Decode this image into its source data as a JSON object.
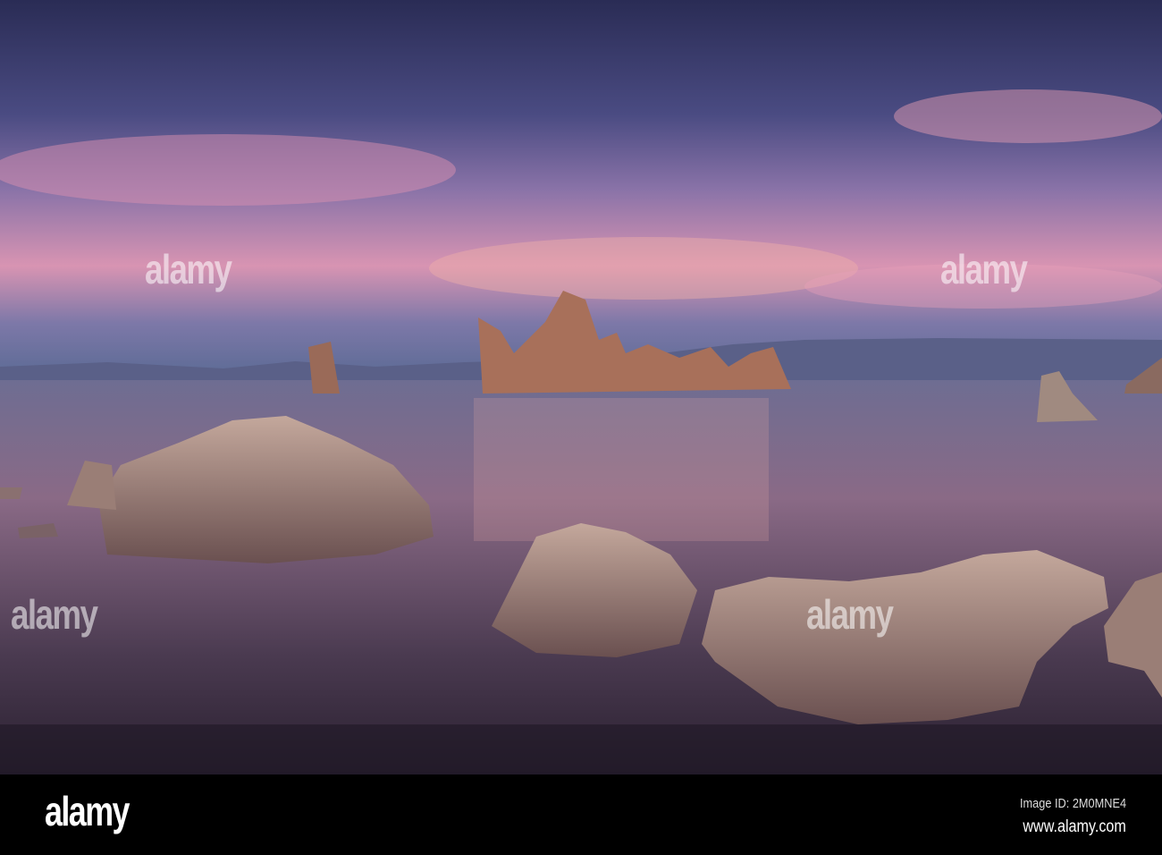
{
  "watermark": {
    "logo_text": "alamy"
  },
  "footer": {
    "logo": "alamy",
    "image_id": "Image ID: 2M0MNE4",
    "url": "www.alamy.com"
  },
  "colors": {
    "sky_top": "#2f3460",
    "sky_pink": "#d98fb0",
    "water": "#6c5a78",
    "rock": "#a08478"
  }
}
